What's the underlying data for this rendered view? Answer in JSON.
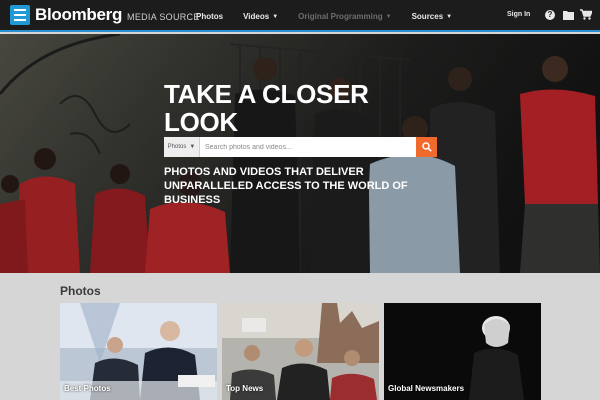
{
  "header": {
    "brand": "Bloomberg",
    "brand_sub": "MEDIA SOURCE",
    "menu_icon": "hamburger-icon",
    "nav": [
      {
        "label": "Photos",
        "has_caret": false,
        "enabled": true
      },
      {
        "label": "Videos",
        "has_caret": true,
        "enabled": true
      },
      {
        "label": "Original Programming",
        "has_caret": true,
        "enabled": false
      },
      {
        "label": "Sources",
        "has_caret": true,
        "enabled": true
      }
    ],
    "sign_in": "Sign In",
    "icons": [
      "help-icon",
      "folder-icon",
      "cart-icon"
    ]
  },
  "hero": {
    "title": "TAKE A CLOSER LOOK",
    "search": {
      "type_label": "Photos",
      "placeholder": "Search photos and videos...",
      "button_icon": "search-icon"
    },
    "subtitle": "PHOTOS AND VIDEOS THAT DELIVER UNPARALLELED ACCESS TO THE WORLD OF BUSINESS"
  },
  "photos": {
    "title": "Photos",
    "cards": [
      {
        "label": "Best Photos"
      },
      {
        "label": "Top News"
      },
      {
        "label": "Global Newsmakers"
      }
    ]
  },
  "colors": {
    "accent": "#1f9ad6",
    "search_button": "#ef6a2c",
    "topbar": "#1c1c1c"
  }
}
